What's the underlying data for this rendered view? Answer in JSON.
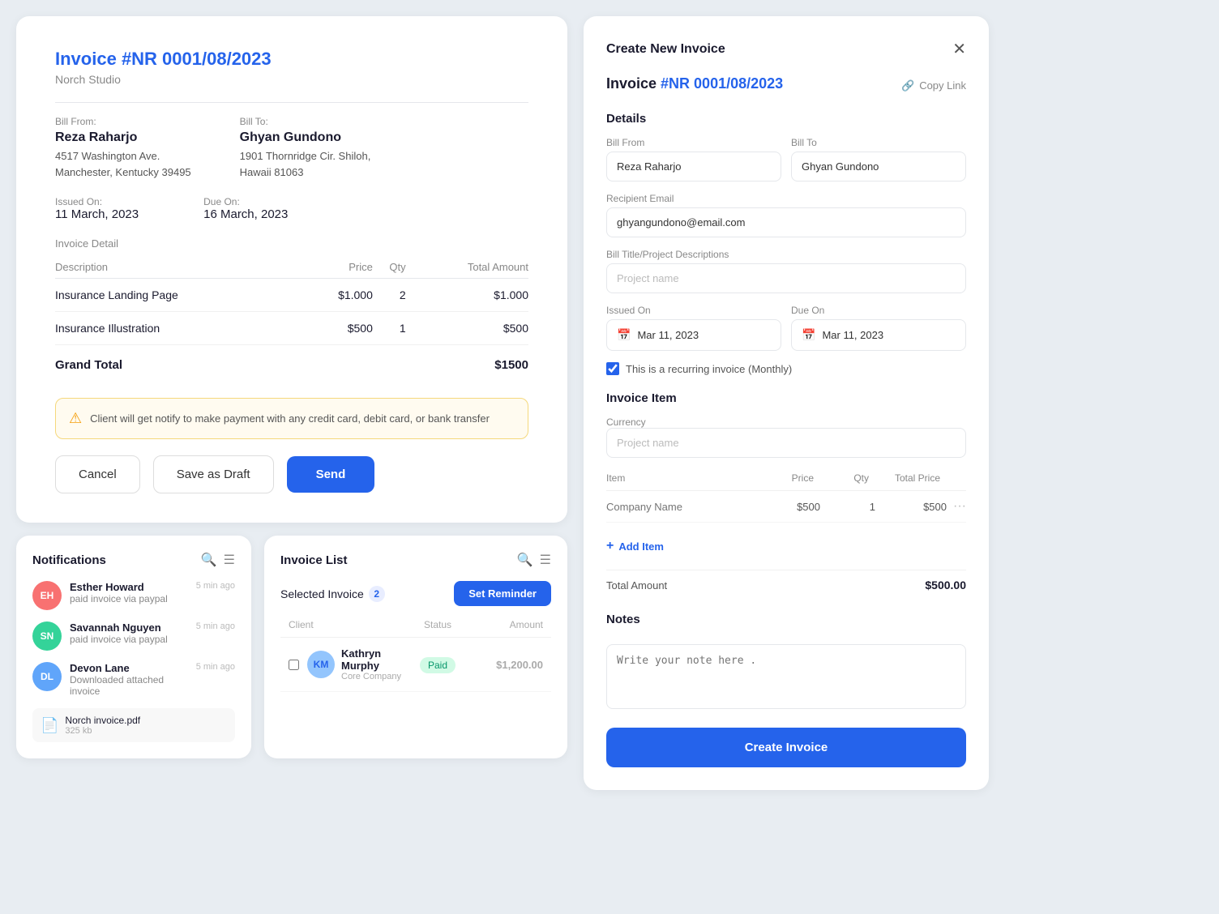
{
  "invoice_preview": {
    "title_prefix": "Invoice",
    "invoice_number": "#NR 0001/08/2023",
    "studio_name": "Norch Studio",
    "bill_from_label": "Bill From:",
    "bill_from_name": "Reza Raharjo",
    "bill_from_address_line1": "4517 Washington Ave.",
    "bill_from_address_line2": "Manchester, Kentucky 39495",
    "bill_to_label": "Bill To:",
    "bill_to_name": "Ghyan Gundono",
    "bill_to_address_line1": "1901 Thornridge Cir. Shiloh,",
    "bill_to_address_line2": "Hawaii 81063",
    "issued_on_label": "Issued On:",
    "issued_on_value": "11 March, 2023",
    "due_on_label": "Due On:",
    "due_on_value": "16 March, 2023",
    "invoice_detail_label": "Invoice Detail",
    "table_headers": {
      "description": "Description",
      "price": "Price",
      "qty": "Qty",
      "total_amount": "Total Amount"
    },
    "line_items": [
      {
        "description": "Insurance Landing Page",
        "price": "$1.000",
        "qty": "2",
        "total": "$1.000"
      },
      {
        "description": "Insurance Illustration",
        "price": "$500",
        "qty": "1",
        "total": "$500"
      }
    ],
    "grand_total_label": "Grand Total",
    "grand_total_value": "$1500",
    "notice_text": "Client will get notify to make payment with any credit card, debit card, or bank transfer",
    "btn_cancel": "Cancel",
    "btn_draft": "Save as Draft",
    "btn_send": "Send"
  },
  "notifications": {
    "title": "Notifications",
    "items": [
      {
        "name": "Esther Howard",
        "action": "paid invoice via paypal",
        "time": "5 min ago",
        "initials": "EH",
        "color": "#f87171"
      },
      {
        "name": "Savannah Nguyen",
        "action": "paid invoice via paypal",
        "time": "5 min ago",
        "initials": "SN",
        "color": "#34d399"
      },
      {
        "name": "Devon Lane",
        "action": "Downloaded attached invoice",
        "time": "5 min ago",
        "initials": "DL",
        "color": "#60a5fa"
      }
    ],
    "file": {
      "name": "Norch invoice.pdf",
      "size": "325 kb"
    }
  },
  "invoice_list": {
    "title": "Invoice List",
    "selected_label": "Selected Invoice",
    "selected_count": "2",
    "btn_reminder": "Set Reminder",
    "columns": {
      "client": "Client",
      "status": "Status",
      "amount": "Amount"
    },
    "items": [
      {
        "name": "Kathryn Murphy",
        "company": "Core Company",
        "status": "Paid",
        "amount": "$1,200.00",
        "initials": "KM",
        "color": "#93c5fd"
      }
    ]
  },
  "right_panel": {
    "title": "Create New Invoice",
    "invoice_number": "#NR 0001/08/2023",
    "copy_link_label": "Copy Link",
    "details_label": "Details",
    "bill_from_label": "Bill From",
    "bill_from_value": "Reza Raharjo",
    "bill_to_label": "Bill To",
    "bill_to_value": "Ghyan Gundono",
    "recipient_email_label": "Recipient Email",
    "recipient_email_value": "ghyangundono@email.com",
    "bill_title_label": "Bill Title/Project Descriptions",
    "bill_title_placeholder": "Project name",
    "issued_on_label": "Issued On",
    "issued_on_value": "Mar 11, 2023",
    "due_on_label": "Due On",
    "due_on_value": "Mar 11, 2023",
    "recurring_label": "This is a recurring invoice (Monthly)",
    "invoice_item_label": "Invoice Item",
    "currency_label": "Currency",
    "currency_placeholder": "Project name",
    "table_headers": {
      "item": "Item",
      "price": "Price",
      "qty": "Qty",
      "total_price": "Total Price"
    },
    "line_item": {
      "name_placeholder": "Company Name",
      "price": "$500",
      "qty": "1",
      "total": "$500"
    },
    "add_item_label": "Add Item",
    "total_amount_label": "Total Amount",
    "total_amount_value": "$500.00",
    "notes_label": "Notes",
    "notes_placeholder": "Write your note here .",
    "btn_create": "Create Invoice"
  }
}
